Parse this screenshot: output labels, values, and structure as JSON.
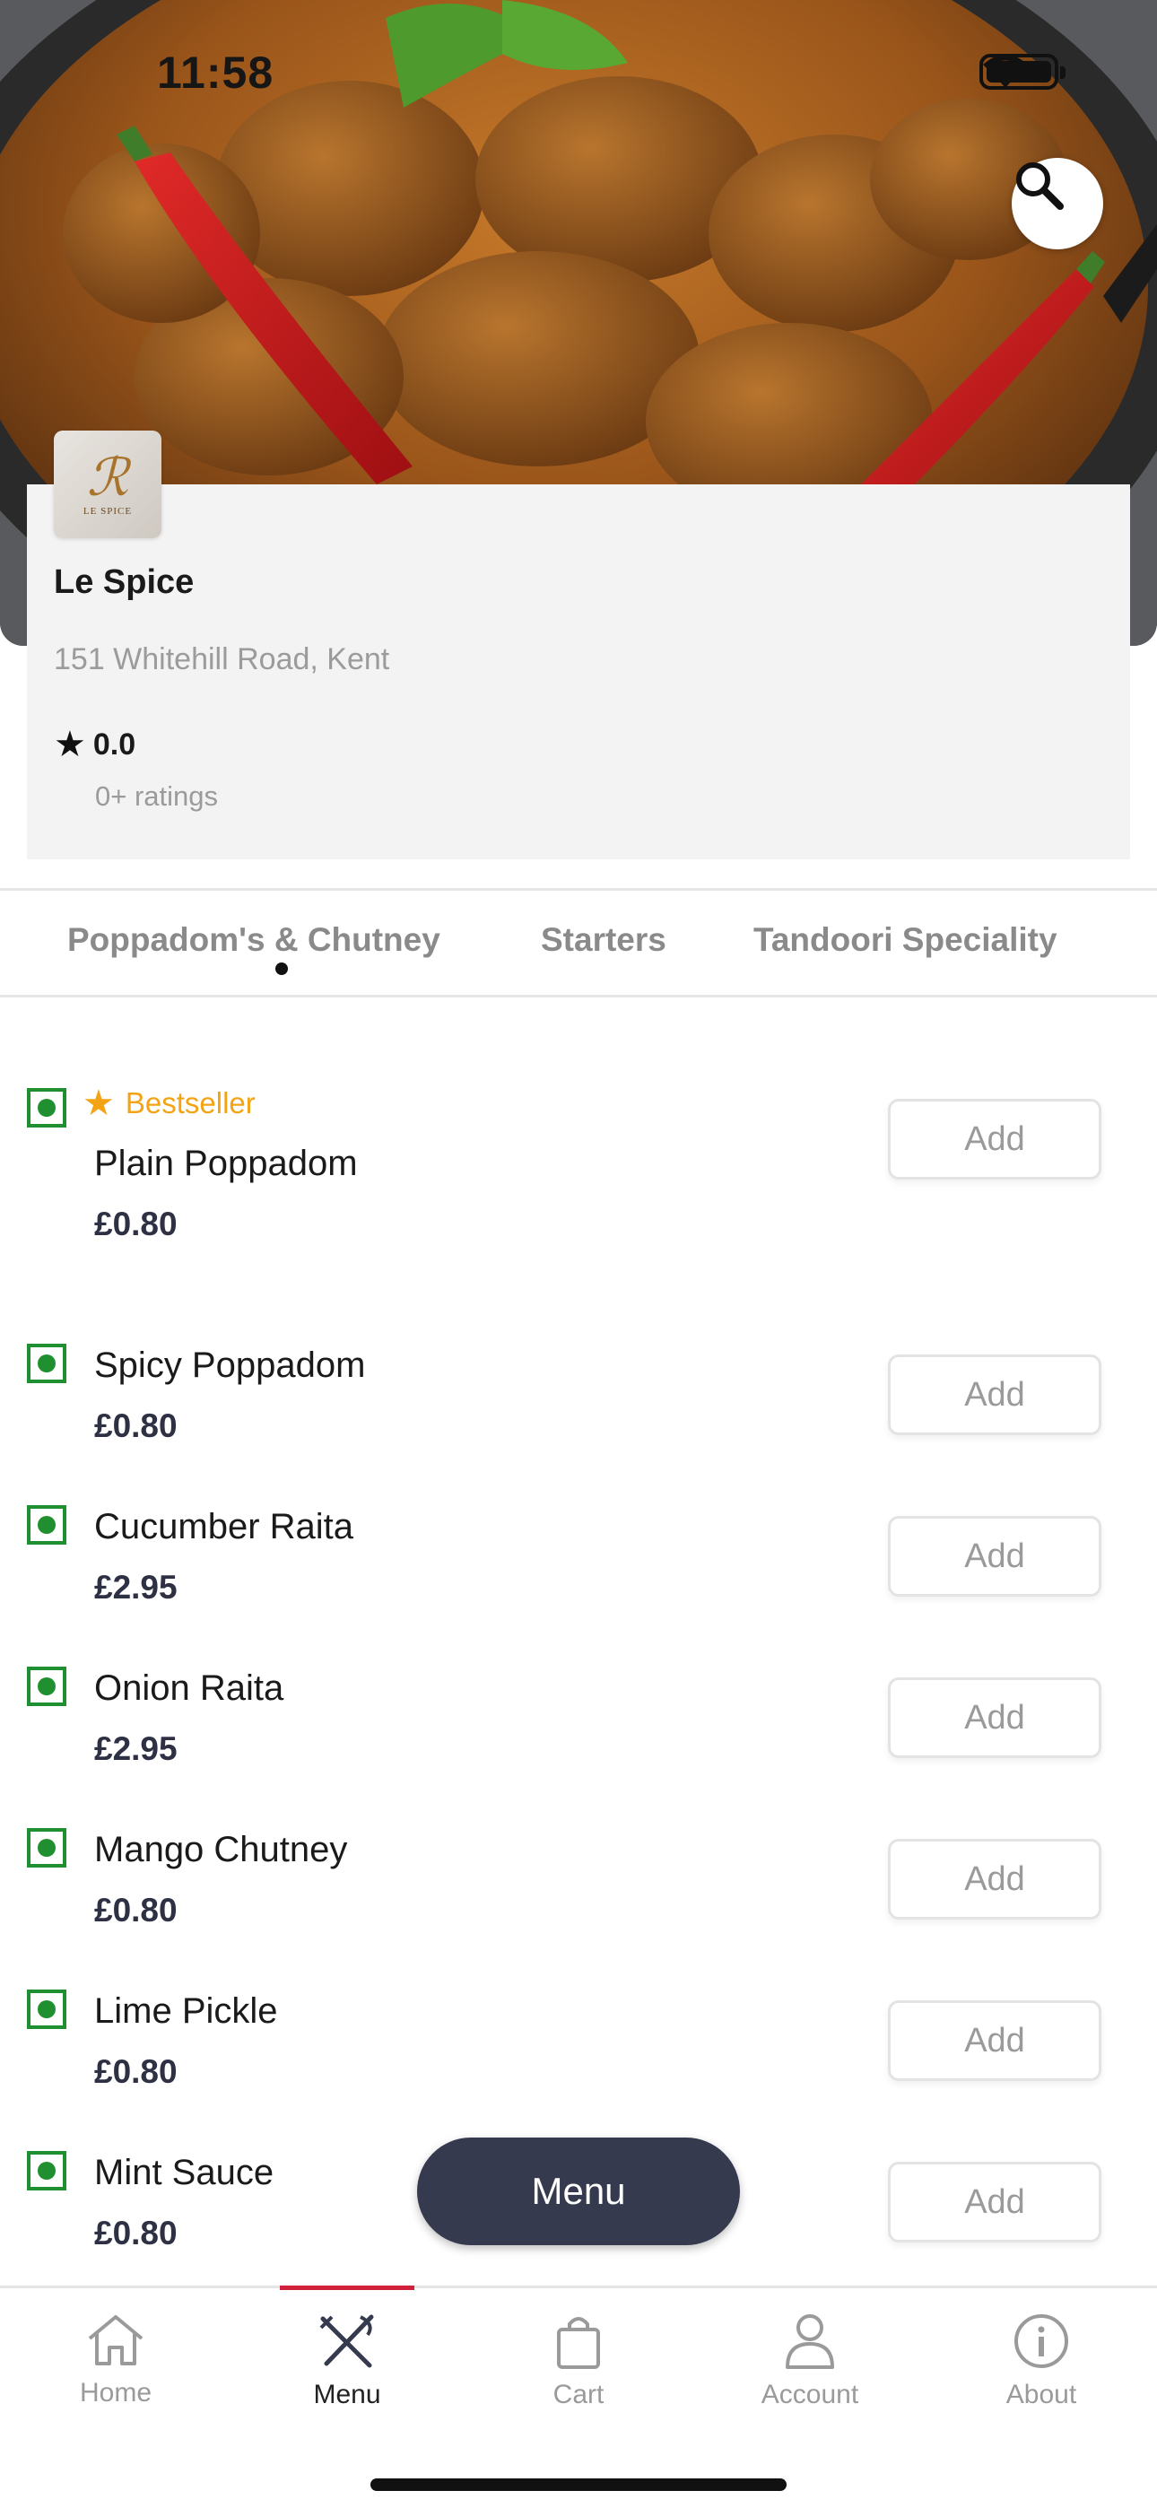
{
  "status_bar": {
    "time": "11:58"
  },
  "restaurant": {
    "name": "Le Spice",
    "logo_text": "LE SPICE",
    "logo_mark": "ℛ",
    "address": "151 Whitehill Road, Kent",
    "rating": "0.0",
    "ratings_count": "0+ ratings"
  },
  "categories": {
    "tabs": [
      "Poppadom's & Chutney",
      "Starters",
      "Tandoori Speciality"
    ],
    "active_index": 0
  },
  "bestseller_label": "Bestseller",
  "add_label": "Add",
  "menu_items": [
    {
      "name": "Plain Poppadom",
      "price": "£0.80",
      "bestseller": true
    },
    {
      "name": "Spicy Poppadom",
      "price": "£0.80"
    },
    {
      "name": "Cucumber Raita",
      "price": "£2.95"
    },
    {
      "name": "Onion Raita",
      "price": "£2.95"
    },
    {
      "name": "Mango Chutney",
      "price": "£0.80"
    },
    {
      "name": "Lime Pickle",
      "price": "£0.80"
    },
    {
      "name": "Mint Sauce",
      "price": "£0.80"
    }
  ],
  "floating_menu_label": "Menu",
  "bottom_nav": {
    "items": [
      {
        "label": "Home",
        "icon": "home-icon"
      },
      {
        "label": "Menu",
        "icon": "fork-knife-icon"
      },
      {
        "label": "Cart",
        "icon": "bag-icon"
      },
      {
        "label": "Account",
        "icon": "person-icon"
      },
      {
        "label": "About",
        "icon": "info-icon"
      }
    ],
    "active_index": 1
  },
  "colors": {
    "veg_green": "#1f8f2f",
    "bestseller_orange": "#f2a416",
    "price_navy": "#2e3143",
    "active_accent": "#d0203a",
    "floating_button": "#353a4e"
  }
}
